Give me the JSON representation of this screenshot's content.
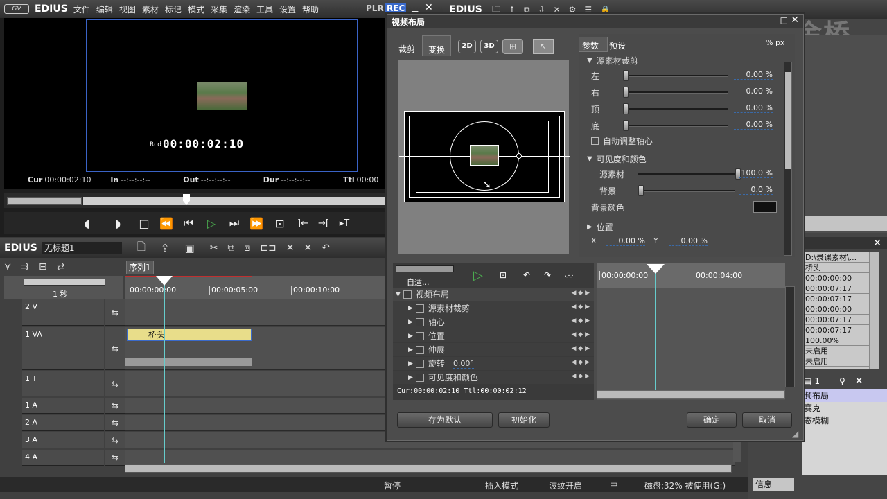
{
  "player": {
    "app_name": "EDIUS",
    "menu": [
      "文件",
      "编辑",
      "视图",
      "素材",
      "标记",
      "模式",
      "采集",
      "渲染",
      "工具",
      "设置",
      "帮助"
    ],
    "plr_label": "PLR",
    "rec_label": "REC",
    "timecode_prefix": "Rcd",
    "timecode": "00:00:02:10",
    "cur_label": "Cur",
    "cur_value": "00:00:02:10",
    "in_label": "In",
    "in_value": "--:--:--:--",
    "out_label": "Out",
    "out_value": "--:--:--:--",
    "dur_label": "Dur",
    "dur_value": "--:--:--:--",
    "ttl_label": "Ttl",
    "ttl_value": "00:00"
  },
  "bin": {
    "app_name": "EDIUS",
    "watermark": "中新金桥",
    "info_values": [
      "D:\\录课素材\\...",
      "桥头",
      "00:00:00:00",
      "00:00:07:17",
      "00:00:07:17",
      "00:00:00:00",
      "00:00:07:17",
      "00:00:07:17",
      "100.00%",
      "未启用",
      "未启用"
    ],
    "effects_count": "1",
    "effects": [
      "频布局",
      "赛克",
      "态模糊"
    ],
    "info_tab": "信息"
  },
  "timeline": {
    "app_name": "EDIUS",
    "project": "无标题1",
    "sequence_tab": "序列1",
    "scale": "1 秒",
    "ruler": [
      "00:00:00:00",
      "00:00:05:00",
      "00:00:10:00"
    ],
    "tracks": [
      {
        "name": "2 V"
      },
      {
        "name": "1 VA"
      },
      {
        "name": "1 T"
      },
      {
        "name": "1 A"
      },
      {
        "name": "2 A"
      },
      {
        "name": "3 A"
      },
      {
        "name": "4 A"
      }
    ],
    "clip_name": "桥头"
  },
  "status": {
    "pause": "暂停",
    "insert_mode": "插入模式",
    "ripple": "波纹开启",
    "disk": "磁盘:32% 被使用(G:)"
  },
  "dialog": {
    "title": "视频布局",
    "tabs": [
      "裁剪",
      "变换"
    ],
    "mode_buttons": [
      "2D",
      "3D"
    ],
    "param_tabs": [
      "参数",
      "预设"
    ],
    "section_crop": "源素材裁剪",
    "crop": [
      {
        "label": "左",
        "value": "0.00 %"
      },
      {
        "label": "右",
        "value": "0.00 %"
      },
      {
        "label": "顶",
        "value": "0.00 %"
      },
      {
        "label": "底",
        "value": "0.00 %"
      }
    ],
    "auto_pivot": "自动调整轴心",
    "section_visibility": "可见度和颜色",
    "source_label": "源素材",
    "source_value": "100.0 %",
    "bg_label": "背景",
    "bg_value": "0.0 %",
    "bg_color_label": "背景颜色",
    "section_position": "位置",
    "pos_x_label": "X",
    "pos_x_value": "0.00 %",
    "pos_y_label": "Y",
    "pos_y_value": "0.00 %",
    "kf_mode": "自适...",
    "kf_ruler": [
      "00:00:00:00",
      "00:00:04:00"
    ],
    "kf_tree": [
      {
        "label": "视频布局",
        "level": 0
      },
      {
        "label": "源素材裁剪",
        "level": 1
      },
      {
        "label": "轴心",
        "level": 1
      },
      {
        "label": "位置",
        "level": 1
      },
      {
        "label": "伸展",
        "level": 1
      },
      {
        "label": "旋转",
        "level": 1,
        "extra": "0.00°"
      },
      {
        "label": "可见度和颜色",
        "level": 1
      }
    ],
    "kf_status": "Cur:00:00:02:10 Ttl:00:00:02:12",
    "btn_save_default": "存为默认",
    "btn_init": "初始化",
    "btn_ok": "确定",
    "btn_cancel": "取消"
  },
  "colors": {
    "accent_green": "#4caf50",
    "rec_blue": "#3a6acb",
    "clip_yellow": "#e8dd8a"
  }
}
